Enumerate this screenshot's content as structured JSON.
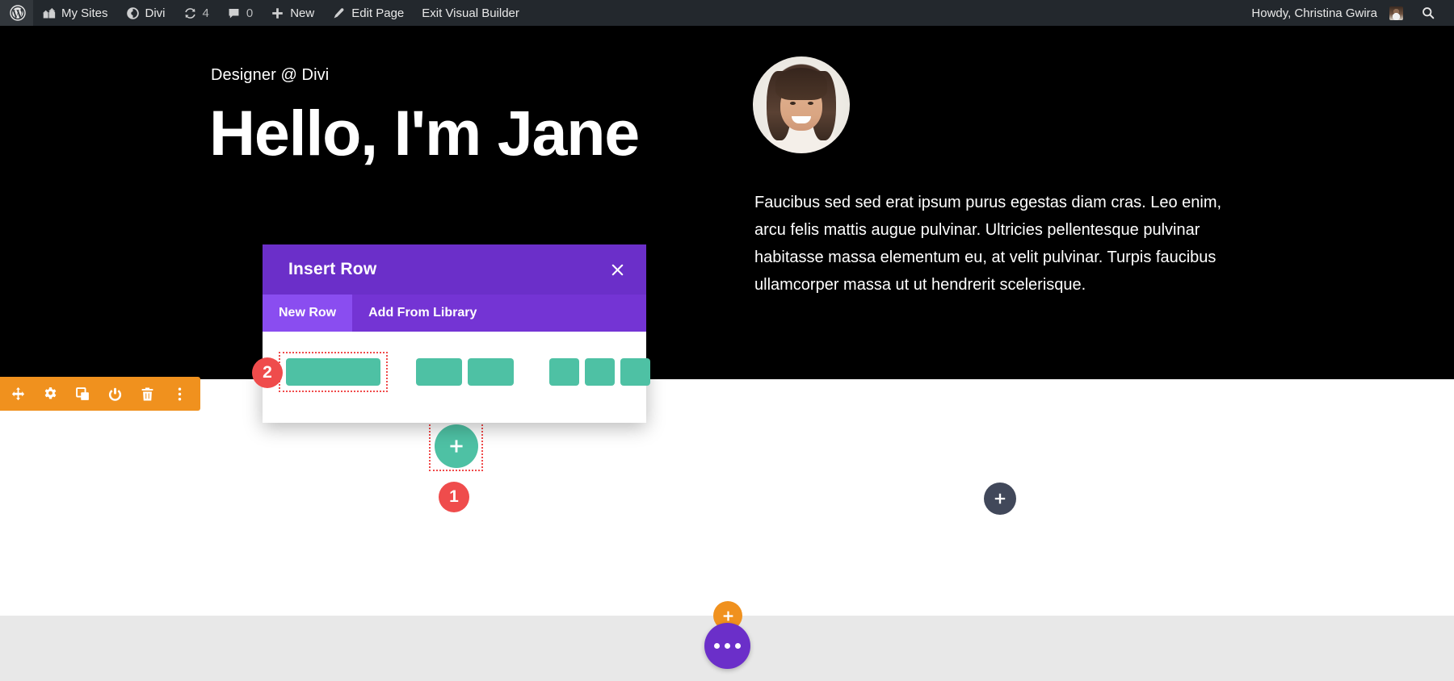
{
  "adminbar": {
    "logo_icon": "wordpress-logo-icon",
    "items": [
      {
        "icon": "my-sites-icon",
        "label": "My Sites"
      },
      {
        "icon": "divi-logo-icon",
        "label": "Divi"
      },
      {
        "icon": "updates-icon",
        "label": "4"
      },
      {
        "icon": "comments-icon",
        "label": "0"
      },
      {
        "icon": "plus-icon",
        "label": "New"
      },
      {
        "icon": "pencil-icon",
        "label": "Edit Page"
      },
      {
        "icon": "",
        "label": "Exit Visual Builder"
      }
    ],
    "account": {
      "greeting": "Howdy, Christina Gwira",
      "avatar_icon": "user-avatar"
    },
    "search_icon": "search-icon"
  },
  "hero": {
    "kicker": "Designer @ Divi",
    "headline": "Hello, I'm Jane",
    "avatar_icon": "profile-photo",
    "body": "Faucibus sed sed erat ipsum purus egestas diam cras. Leo enim, arcu felis mattis augue pulvinar. Ultricies pellentesque pulvinar habitasse massa elementum eu, at velit pulvinar. Turpis faucibus ullamcorper massa ut ut hendrerit scelerisque."
  },
  "section_toolbar": {
    "buttons": [
      {
        "icon": "move-icon",
        "title": "Move Section"
      },
      {
        "icon": "gear-icon",
        "title": "Section Settings"
      },
      {
        "icon": "duplicate-icon",
        "title": "Duplicate Section"
      },
      {
        "icon": "power-icon",
        "title": "Disable Section"
      },
      {
        "icon": "trash-icon",
        "title": "Delete Section"
      },
      {
        "icon": "more-vertical-icon",
        "title": "More Options"
      }
    ]
  },
  "canvas": {
    "add_row_button": {
      "icon": "plus-icon",
      "label": "Add New Row"
    },
    "add_column_button": {
      "icon": "plus-icon",
      "label": "Add New Module"
    },
    "add_section_button": {
      "icon": "plus-icon",
      "label": "Add New Section"
    },
    "page_menu_button": {
      "icon": "ellipsis-icon",
      "label": "Page Settings Menu"
    }
  },
  "callouts": [
    {
      "number": "1",
      "target": "add-row-button"
    },
    {
      "number": "2",
      "target": "row-layout-one-column"
    }
  ],
  "modal": {
    "title": "Insert Row",
    "close_icon": "close-icon",
    "tabs": [
      {
        "label": "New Row",
        "active": true
      },
      {
        "label": "Add From Library",
        "active": false
      }
    ],
    "layouts": [
      {
        "name": "1 Column",
        "columns": 1,
        "selected": true
      },
      {
        "name": "2 Columns",
        "columns": 2,
        "selected": false
      },
      {
        "name": "3 Columns",
        "columns": 3,
        "selected": false
      }
    ]
  },
  "colors": {
    "adminbar": "#23282d",
    "modal_header": "#6b2fc9",
    "modal_tabbar": "#7434d4",
    "modal_tab_active": "#8a4df0",
    "accent_teal": "#4ec1a4",
    "accent_orange": "#f0911e",
    "badge_red": "#ef4c4c",
    "dark_section": "#000000",
    "gray_section": "#e8e8e8",
    "gray_add": "#41485a"
  }
}
